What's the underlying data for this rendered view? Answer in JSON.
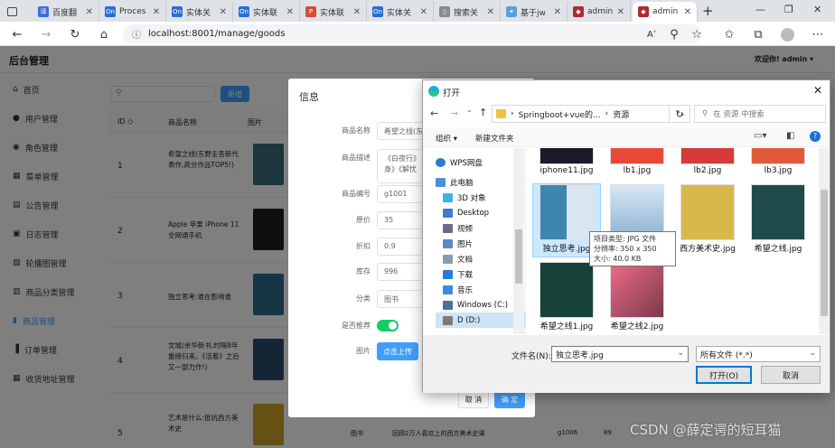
{
  "browser": {
    "tabs": [
      {
        "label": "",
        "icon": "tab-actions-icon"
      },
      {
        "label": "百度翻",
        "icon": "translate-icon"
      },
      {
        "label": "Proces",
        "icon": "onenote-icon"
      },
      {
        "label": "实体关",
        "icon": "onenote-icon"
      },
      {
        "label": "实体联",
        "icon": "onenote-icon"
      },
      {
        "label": "实体联",
        "icon": "pdf-icon"
      },
      {
        "label": "实体关",
        "icon": "onenote-icon"
      },
      {
        "label": "搜索关",
        "icon": "clipboard-icon"
      },
      {
        "label": "基于jw",
        "icon": "bird-icon"
      },
      {
        "label": "admin",
        "icon": "site-icon"
      },
      {
        "label": "admin",
        "icon": "site-icon"
      }
    ],
    "url": "localhost:8001/manage/goods",
    "new_tab": "+"
  },
  "app": {
    "title": "后台管理",
    "greeting": "欢迎你! admin ▾",
    "menu": [
      "首页",
      "用户管理",
      "角色管理",
      "菜单管理",
      "公告管理",
      "日志管理",
      "轮播图管理",
      "商品分类管理",
      "商品管理",
      "订单管理",
      "收货地址管理"
    ],
    "search_button": "新增",
    "table_headers": [
      "ID ◇",
      "商品名称",
      "图片"
    ],
    "rows": [
      {
        "id": "1",
        "name": "希望之线(东野圭吾新代表作,高分作品TOP5!)"
      },
      {
        "id": "2",
        "name": "Apple 苹果 iPhone 11 全网通手机"
      },
      {
        "id": "3",
        "name": "独立思考:谁在影响谁"
      },
      {
        "id": "4",
        "name": "文城(余华新书,时隔8年重磅归来。《活着》之后又一部力作!)"
      },
      {
        "id": "5",
        "name": "艺术是什么:抵抗西方美术史"
      }
    ],
    "row5_extra": [
      "图书",
      "回顾2万人喜欢上的西方美术史课",
      "g1006",
      "89"
    ]
  },
  "edit_dialog": {
    "title": "信息",
    "fields": [
      {
        "label": "商品名称",
        "value": "希望之线(东"
      },
      {
        "label": "商品描述",
        "value": "《白夜行》\n身》《解忧"
      },
      {
        "label": "商品编号",
        "value": "g1001"
      },
      {
        "label": "原价",
        "value": "35"
      },
      {
        "label": "折扣",
        "value": "0.9"
      },
      {
        "label": "库存",
        "value": "996"
      },
      {
        "label": "分类",
        "value": "图书"
      },
      {
        "label": "是否推荐",
        "value": ""
      },
      {
        "label": "图片",
        "value": ""
      }
    ],
    "upload_button": "点击上传",
    "recommend_on": true,
    "cancel": "取 消",
    "confirm": "确 定"
  },
  "file_dialog": {
    "title": "打开",
    "breadcrumb": [
      "Springboot+vue的...",
      "资源"
    ],
    "search_placeholder": "在 资源 中搜索",
    "organize": "组织 ▾",
    "new_folder": "新建文件夹",
    "tree": [
      "WPS网盘",
      "此电脑",
      "3D 对象",
      "Desktop",
      "视频",
      "图片",
      "文档",
      "下载",
      "音乐",
      "Windows (C:)",
      "D (D:)"
    ],
    "files_top": [
      "iphone11.jpg",
      "lb1.jpg",
      "lb2.jpg",
      "lb3.jpg"
    ],
    "files_mid": [
      "独立思考.jpg",
      "",
      "西方美术史.jpg",
      "希望之线.jpg"
    ],
    "files_bottom": [
      "希望之线1.jpg",
      "希望之线2.jpg"
    ],
    "tooltip": [
      "项目类型: JPG 文件",
      "分辨率: 350 x 350",
      "大小: 40.0 KB"
    ],
    "filename_label": "文件名(N):",
    "filename_value": "独立思考.jpg",
    "filetype": "所有文件 (*.*)",
    "open_button": "打开(O)",
    "cancel_button": "取消"
  },
  "watermark": "CSDN @薛定谔的短耳猫"
}
